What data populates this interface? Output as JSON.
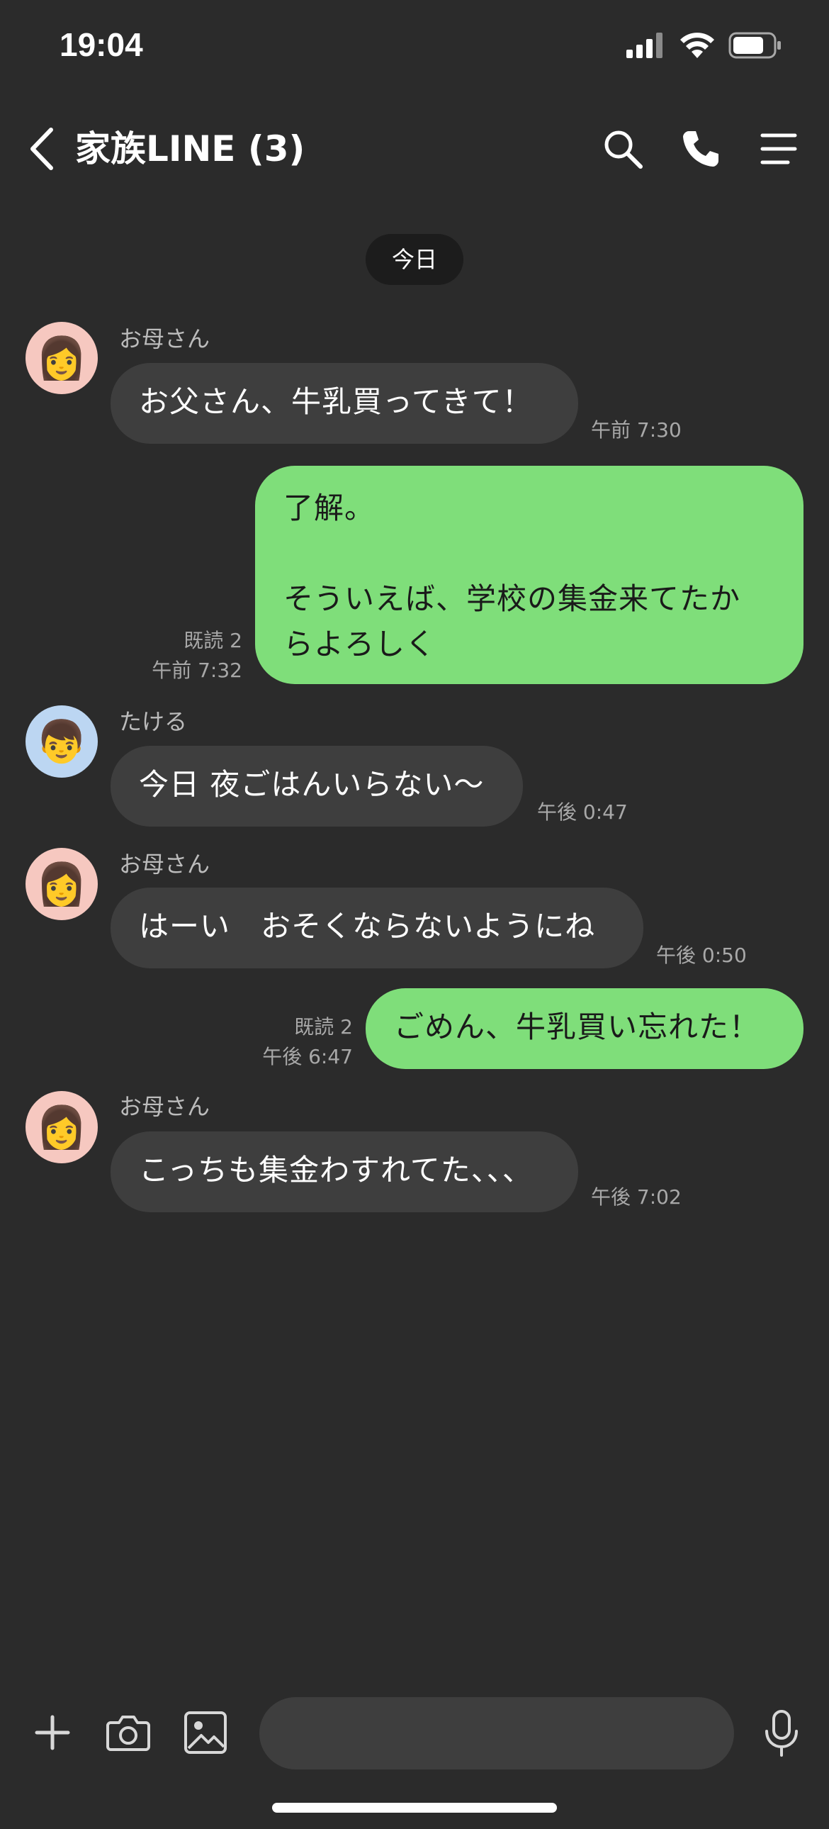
{
  "status_bar": {
    "time": "19:04"
  },
  "header": {
    "title": "家族LINE (3)"
  },
  "date_divider": "今日",
  "messages": [
    {
      "side": "in",
      "sender": "お母さん",
      "text": "お父さん、牛乳買ってきて！",
      "time": "午前 7:30"
    },
    {
      "side": "out",
      "lines": [
        "了解。",
        "",
        "そういえば、学校の集金来てたか",
        "らよろしく"
      ],
      "read": "既読 2",
      "time": "午前 7:32"
    },
    {
      "side": "in",
      "sender": "たける",
      "text": "今日 夜ごはんいらない〜",
      "time": "午後 0:47"
    },
    {
      "side": "in",
      "sender": "お母さん",
      "text": "はーい　おそくならないようにね",
      "time": "午後 0:50"
    },
    {
      "side": "out",
      "text": "ごめん、牛乳買い忘れた！",
      "read": "既読 2",
      "time": "午後 6:47"
    },
    {
      "side": "in",
      "sender": "お母さん",
      "text": "こっちも集金わすれてた、、、",
      "time": "午後 7:02"
    }
  ],
  "composer": {
    "placeholder": ""
  },
  "colors": {
    "background": "#2b2b2b",
    "incoming_bubble": "#3e3e3e",
    "outgoing_bubble": "#7fde7a",
    "meta_text": "#a8a8a8"
  },
  "icons": [
    "signal-icon",
    "wifi-icon",
    "battery-icon",
    "back-icon",
    "search-icon",
    "phone-icon",
    "menu-icon",
    "plus-icon",
    "camera-icon",
    "image-icon",
    "microphone-icon",
    "woman-emoji-avatar",
    "boy-emoji-avatar"
  ]
}
